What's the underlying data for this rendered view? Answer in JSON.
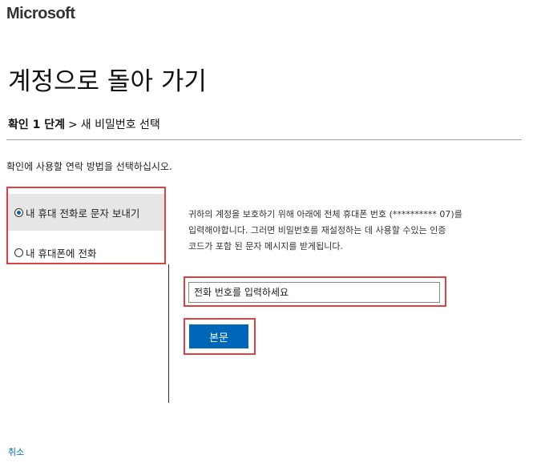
{
  "brand": {
    "name": "Microsoft"
  },
  "page": {
    "title": "계정으로 돌아 가기"
  },
  "breadcrumb": {
    "current_step": "확인 1 단계",
    "separator": ">",
    "next_step": "새 비밀번호 선택"
  },
  "instruction": "확인에 사용할 연락 방법을 선택하십시오.",
  "options": [
    {
      "label": "내 휴대 전화로 문자 보내기",
      "selected": true
    },
    {
      "label": "내 휴대폰에 전화",
      "selected": false
    }
  ],
  "description": {
    "line1": "귀하의 계정을 보호하기 위해 아래에 전체 휴대폰 번호 (********** 07)를",
    "line2": "입력해야합니다. 그러면 비밀번호를 재설정하는 데 사용할 수있는 인증",
    "line3": "코드가 포함 된 문자 메시지를 받게됩니다."
  },
  "phone_input": {
    "placeholder": "전화 번호를 입력하세요",
    "value": ""
  },
  "submit_button": {
    "label": "본문"
  },
  "cancel_link": {
    "label": "취소"
  },
  "colors": {
    "accent": "#0067b8",
    "highlight_border": "#e04040",
    "selected_bg": "#e6e6e6"
  },
  "icons": {
    "radio_checked": "radio-checked-icon",
    "radio_unchecked": "radio-unchecked-icon"
  }
}
